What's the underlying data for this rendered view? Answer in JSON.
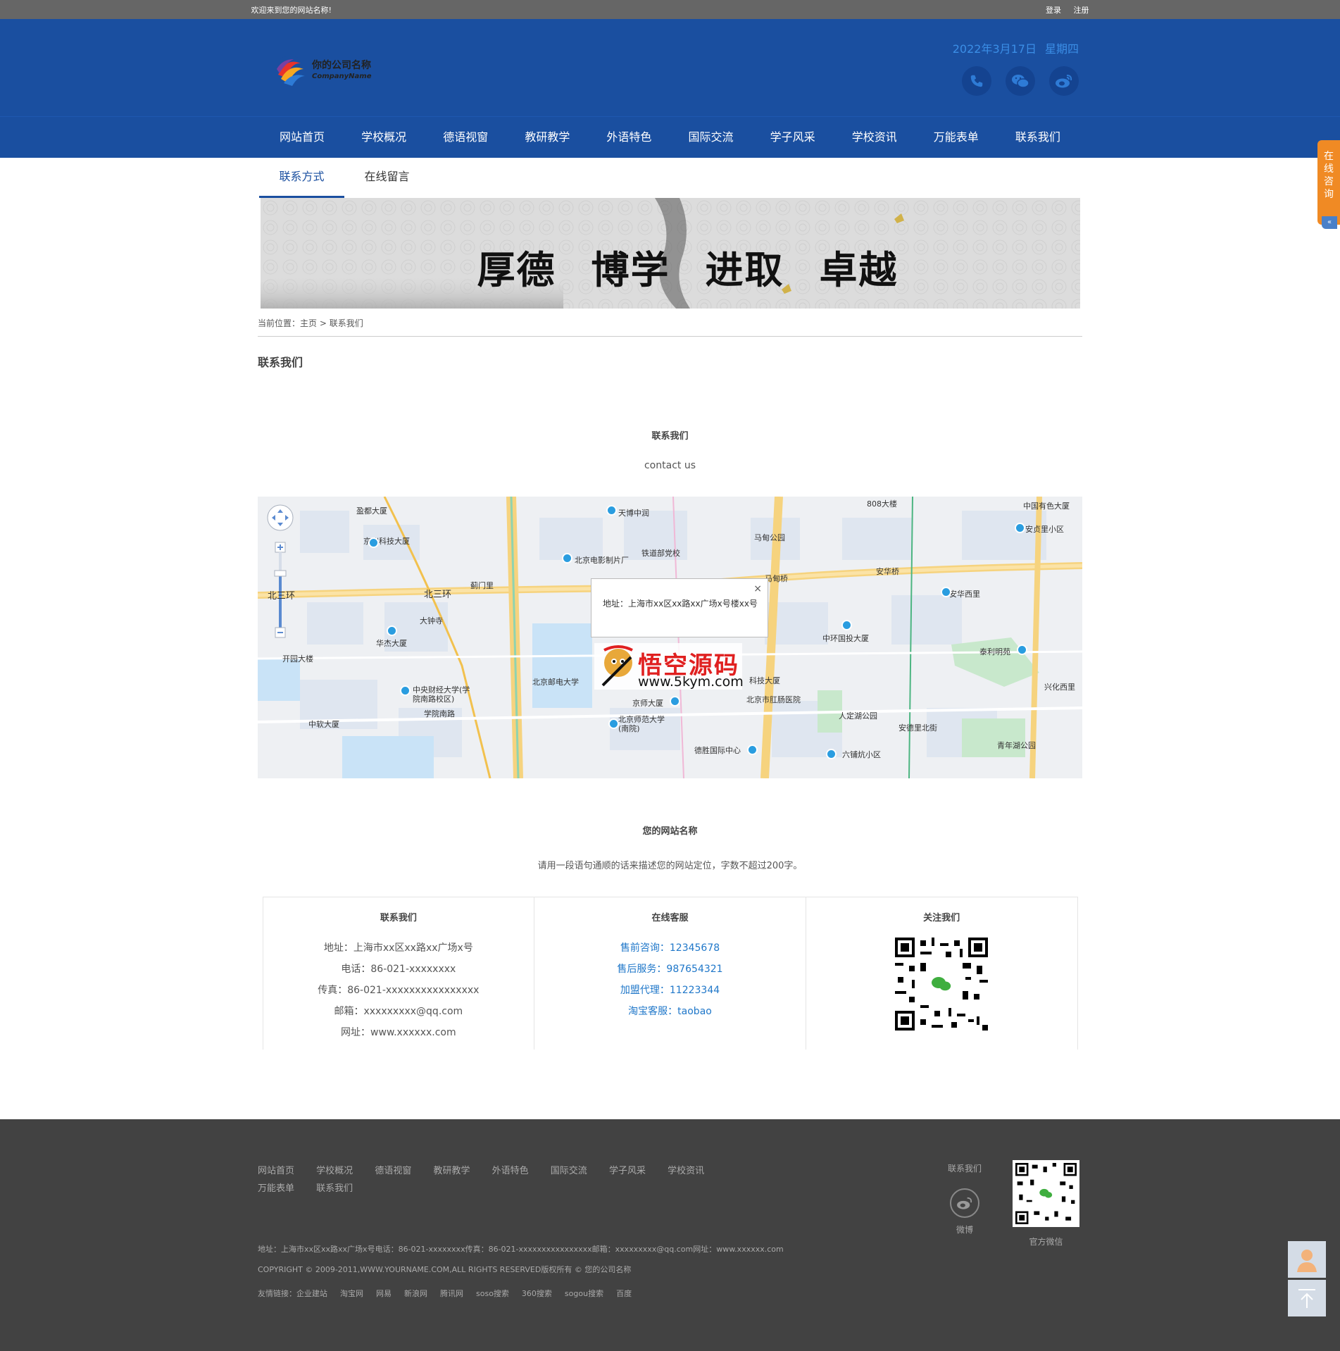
{
  "topbar": {
    "welcome": "欢迎来到您的网站名称!",
    "login": "登录",
    "register": "注册"
  },
  "header": {
    "company_cn": "你的公司名称",
    "company_en": "CompanyName",
    "date": "2022年3月17日",
    "weekday": "星期四",
    "icons": [
      "phone-icon",
      "wechat-icon",
      "weibo-icon"
    ]
  },
  "nav": {
    "items": [
      "网站首页",
      "学校概况",
      "德语视窗",
      "教研教学",
      "外语特色",
      "国际交流",
      "学子风采",
      "学校资讯",
      "万能表单",
      "联系我们"
    ]
  },
  "subtabs": {
    "items": [
      "联系方式",
      "在线留言"
    ],
    "active": 0
  },
  "banner": {
    "motto": [
      "厚德",
      "博学",
      "进取",
      "卓越"
    ]
  },
  "breadcrumb": {
    "prefix": "当前位置：",
    "home": "主页",
    "sep": ">",
    "current": "联系我们"
  },
  "page_title": "联系我们",
  "contact_section": {
    "title": "联系我们",
    "subtitle": "contact us"
  },
  "map": {
    "popup_text": "地址：上海市xx区xx路xx广场x号楼xx号",
    "popup_close": "×",
    "watermark_cn": "悟空源码",
    "watermark_en": "www.5kym.com",
    "labels": [
      "盈都大厦",
      "京仪科技大厦",
      "天博中润",
      "北京电影制片厂",
      "铁道部党校",
      "马甸公园",
      "808大楼",
      "中国有色大厦",
      "安贞里小区",
      "北三环",
      "北三环",
      "蓟门里",
      "大钟寺",
      "马甸桥",
      "安华桥",
      "安华西里",
      "华杰大厦",
      "中环国投大厦",
      "泰利明苑",
      "北京邮电大学",
      "开园大楼",
      "中央财经大学(学院南路校区)",
      "学院南路",
      "京师大厦",
      "北京市肛肠医院",
      "人定湖公园",
      "安德里北街",
      "兴化西里",
      "中软大厦",
      "北京师范大学(南院)",
      "德胜国际中心",
      "六铺炕小区",
      "青年湖公园",
      "科技大厦"
    ]
  },
  "site_section": {
    "title": "您的网站名称",
    "description": "请用一段语句通顺的话来描述您的网站定位，字数不超过200字。"
  },
  "columns": {
    "contact": {
      "title": "联系我们",
      "lines": [
        "地址：上海市xx区xx路xx广场x号",
        "电话：86-021-xxxxxxxx",
        "传真：86-021-xxxxxxxxxxxxxxxx",
        "邮箱：xxxxxxxxx@qq.com",
        "网址：www.xxxxxx.com"
      ]
    },
    "service": {
      "title": "在线客服",
      "lines": [
        "售前咨询：12345678",
        "售后服务：987654321",
        "加盟代理：11223344",
        "淘宝客服：taobao"
      ]
    },
    "follow": {
      "title": "关注我们"
    }
  },
  "footer": {
    "nav": [
      "网站首页",
      "学校概况",
      "德语视窗",
      "教研教学",
      "外语特色",
      "国际交流",
      "学子风采",
      "学校资讯",
      "万能表单",
      "联系我们"
    ],
    "info": "地址：上海市xx区xx路xx广场x号电话：86-021-xxxxxxxx传真：86-021-xxxxxxxxxxxxxxxx邮箱：xxxxxxxxx@qq.com网址：www.xxxxxx.com",
    "copyright": "COPYRIGHT © 2009-2011,WWW.YOURNAME.COM,ALL RIGHTS RESERVED版权所有 © 您的公司名称",
    "links_label": "友情链接：",
    "links": [
      "企业建站",
      "淘宝网",
      "网易",
      "新浪网",
      "腾讯网",
      "soso搜索",
      "360搜索",
      "sogou搜索",
      "百度"
    ],
    "contact_label": "联系我们",
    "weibo_label": "微博",
    "wechat_label": "官方微信"
  },
  "side": {
    "consult": [
      "在",
      "线",
      "咨",
      "询"
    ],
    "collapse": "«"
  },
  "colors": {
    "brand_blue": "#1a4fa0",
    "topbar_gray": "#666666",
    "footer_dark": "#424242",
    "accent_orange": "#f08a24",
    "link_blue": "#1f77c9"
  }
}
